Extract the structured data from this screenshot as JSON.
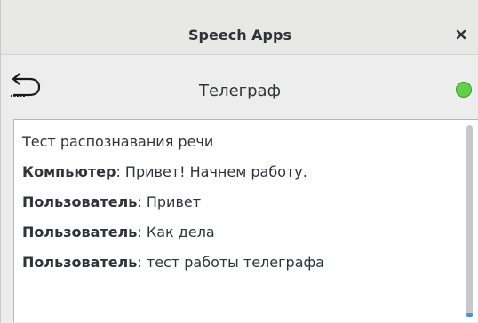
{
  "window": {
    "title": "Speech Apps",
    "close_icon": "close-icon"
  },
  "header": {
    "title": "Телеграф",
    "back_icon": "back-arrow-icon",
    "status_color": "#62d04a"
  },
  "transcript": [
    {
      "speaker": "",
      "text": "Тест распознавания речи"
    },
    {
      "speaker": "Компьютер",
      "text": ": Привет! Начнем работу."
    },
    {
      "speaker": "Пользователь",
      "text": ": Привет"
    },
    {
      "speaker": "Пользователь",
      "text": ": Как дела"
    },
    {
      "speaker": "Пользователь",
      "text": ": тест работы телеграфа"
    }
  ]
}
